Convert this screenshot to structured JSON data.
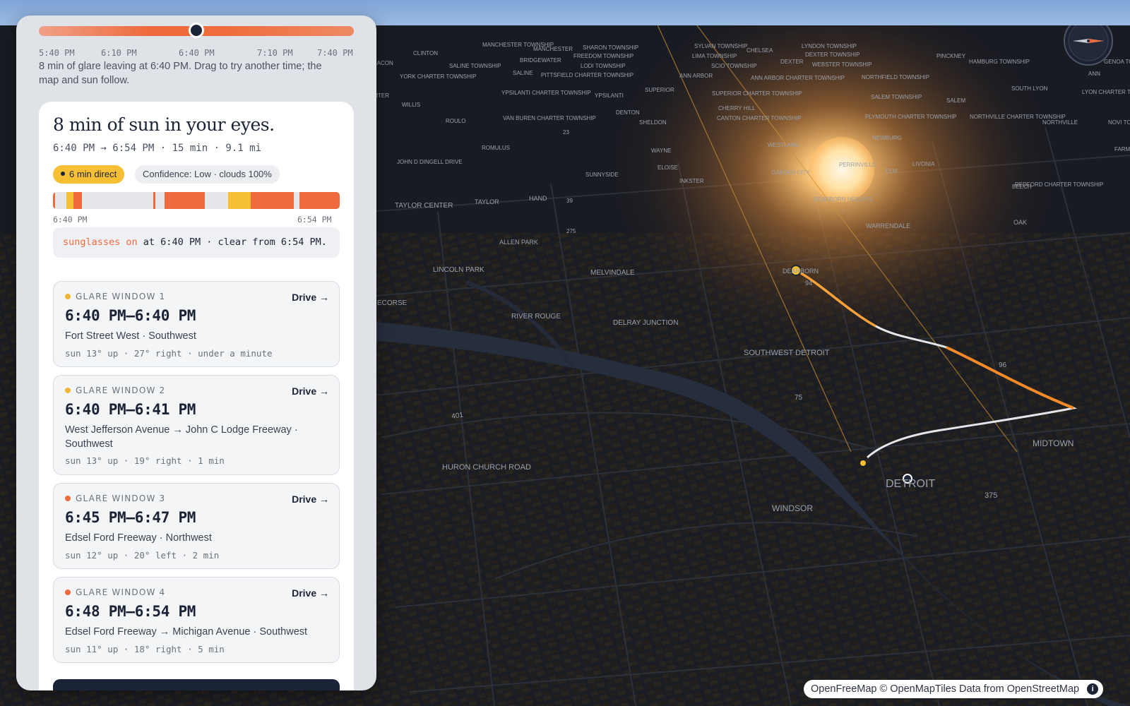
{
  "slider": {
    "ticks": [
      "5:40 PM",
      "6:10 PM",
      "6:40 PM",
      "7:10 PM",
      "7:40 PM"
    ],
    "position": 0.5,
    "hint": "8 min of glare leaving at 6:40 PM. Drag to try another time; the map and sun follow."
  },
  "summary": {
    "headline": "8 min of sun in your eyes.",
    "subline": "6:40 PM → 6:54 PM · 15 min · 9.1 mi",
    "direct_badge": "6 min direct",
    "confidence_badge": "Confidence: Low · clouds 100%",
    "bar_start": "6:40 PM",
    "bar_end": "6:54 PM",
    "note_warn": "sunglasses on",
    "note_rest": " at 6:40 PM · clear from 6:54 PM."
  },
  "glare_bar_segments": [
    {
      "from": 0.0,
      "to": 0.008,
      "level": "orange"
    },
    {
      "from": 0.048,
      "to": 0.072,
      "level": "yellow"
    },
    {
      "from": 0.072,
      "to": 0.1,
      "level": "orange"
    },
    {
      "from": 0.35,
      "to": 0.358,
      "level": "orange"
    },
    {
      "from": 0.39,
      "to": 0.53,
      "level": "orange"
    },
    {
      "from": 0.61,
      "to": 0.69,
      "level": "yellow"
    },
    {
      "from": 0.69,
      "to": 0.84,
      "level": "orange"
    },
    {
      "from": 0.86,
      "to": 1.0,
      "level": "orange"
    }
  ],
  "windows": [
    {
      "label": "GLARE WINDOW 1",
      "time": "6:40 PM–6:40 PM",
      "road": "Fort Street West · Southwest",
      "meta": "sun 13° up · 27° right · under a minute",
      "dot": "#f5b731",
      "drive": "Drive →"
    },
    {
      "label": "GLARE WINDOW 2",
      "time": "6:40 PM–6:41 PM",
      "road": "West Jefferson Avenue → John C Lodge Freeway · Southwest",
      "meta": "sun 13° up · 19° right · 1 min",
      "dot": "#f5b731",
      "drive": "Drive →"
    },
    {
      "label": "GLARE WINDOW 3",
      "time": "6:45 PM–6:47 PM",
      "road": "Edsel Ford Freeway · Northwest",
      "meta": "sun 12° up · 20° left · 2 min",
      "dot": "#ee6a3c",
      "drive": "Drive →"
    },
    {
      "label": "GLARE WINDOW 4",
      "time": "6:48 PM–6:54 PM",
      "road": "Edsel Ford Freeway → Michigan Avenue · Southwest",
      "meta": "sun 11° up · 18° right · 5 min",
      "dot": "#ee6a3c",
      "drive": "Drive →"
    }
  ],
  "map": {
    "labels": [
      "MANCHESTER TOWNSHIP",
      "MANCHESTER",
      "SHARON TOWNSHIP",
      "SYLVAN TOWNSHIP",
      "LYNDON TOWNSHIP",
      "CHELSEA",
      "CLINTON",
      "BRIDGEWATER",
      "FREEDOM TOWNSHIP",
      "LIMA TOWNSHIP",
      "DEXTER TOWNSHIP",
      "PINCKNEY",
      "MACON",
      "SALINE TOWNSHIP",
      "LODI TOWNSHIP",
      "SCIO TOWNSHIP",
      "DEXTER",
      "WEBSTER TOWNSHIP",
      "HAMBURG TOWNSHIP",
      "GENOA TOWNSHIP",
      "YORK CHARTER TOWNSHIP",
      "SALINE",
      "PITTSFIELD CHARTER TOWNSHIP",
      "ANN ARBOR",
      "ANN ARBOR CHARTER TOWNSHIP",
      "NORTHFIELD TOWNSHIP",
      "ARTER",
      "YPSILANTI CHARTER TOWNSHIP",
      "YPSILANTI",
      "SUPERIOR",
      "SUPERIOR CHARTER TOWNSHIP",
      "CHERRY HILL",
      "SALEM TOWNSHIP",
      "SOUTH LYON",
      "LYON CHARTER TOWNSHIP",
      "WILLIS",
      "CANTON CHARTER TOWNSHIP",
      "DENTON",
      "SALEM",
      "ROULO",
      "VAN BUREN CHARTER TOWNSHIP",
      "SHELDON",
      "PLYMOUTH CHARTER TOWNSHIP",
      "NORTHVILLE CHARTER TOWNSHIP",
      "NORTHVILLE",
      "NOVI TOWNSHIP",
      "NEWBURG",
      "ROMULUS",
      "WAYNE",
      "WESTLAND",
      "FARMI",
      "PERRINVILLE",
      "LIVONIA",
      "JOHN D DINGELL DRIVE",
      "ELOISE",
      "GARDEN CITY",
      "ELM",
      "BEECH",
      "REDFORD CHARTER TOWNSHIP",
      "SUNNYSIDE",
      "INKSTER",
      "DEARBORN HEIGHTS",
      "TAYLOR CENTER",
      "TAYLOR",
      "HAND",
      "WARRENDALE",
      "OAK",
      "ALLEN PARK",
      "DEARBORN",
      "LINCOLN PARK",
      "MELVINDALE",
      "ECORSE",
      "RIVER ROUGE",
      "DELRAY JUNCTION",
      "SOUTHWEST DETROIT",
      "401",
      "HURON CHURCH ROAD",
      "WINDSOR",
      "DETROIT",
      "MIDTOWN",
      "375",
      "75",
      "96",
      "94",
      "39",
      "275",
      "23",
      "ANN"
    ]
  },
  "attribution": {
    "a": "OpenFreeMap",
    "b": " © ",
    "c": "OpenMapTiles",
    "d": " Data from ",
    "e": "OpenStreetMap",
    "info": "i"
  },
  "colors": {
    "accent": "#ee6a3c",
    "yellow": "#f7bf34",
    "ink": "#1b2437"
  }
}
